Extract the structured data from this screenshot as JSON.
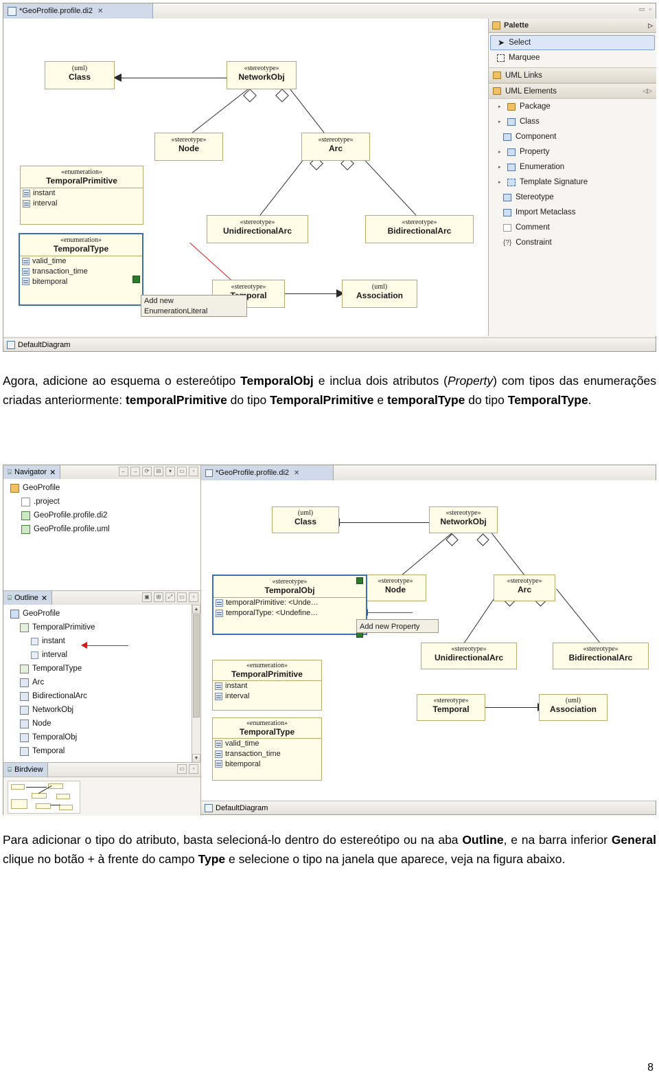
{
  "page": {
    "number": "8"
  },
  "screenshot_top": {
    "editor_tab": {
      "label": "*GeoProfile.profile.di2",
      "close_glyph": "✕",
      "icon": "diagram-icon"
    },
    "window_buttons": {
      "minimize": "▭",
      "maximize": "▫"
    },
    "status_tab": {
      "label": "DefaultDiagram",
      "icon": "diagram-icon"
    },
    "diagram": {
      "classes": [
        {
          "stereotype": "(uml)",
          "name": "Class"
        },
        {
          "stereotype": "«stereotype»",
          "name": "NetworkObj"
        },
        {
          "stereotype": "«stereotype»",
          "name": "Node"
        },
        {
          "stereotype": "«stereotype»",
          "name": "Arc"
        },
        {
          "stereotype": "«stereotype»",
          "name": "UnidirectionalArc"
        },
        {
          "stereotype": "«stereotype»",
          "name": "BidirectionalArc"
        },
        {
          "stereotype": "«stereotype»",
          "name": "Temporal"
        },
        {
          "stereotype": "(uml)",
          "name": "Association"
        }
      ],
      "enumerations": [
        {
          "stereotype": "«enumeration»",
          "name": "TemporalPrimitive",
          "literals": [
            "instant",
            "interval"
          ]
        },
        {
          "stereotype": "«enumeration»",
          "name": "TemporalType",
          "literals": [
            "valid_time",
            "transaction_time",
            "bitemporal"
          ]
        }
      ],
      "hint": "Add new\nEnumerationLiteral",
      "hint_line1": "Add new",
      "hint_line2": "EnumerationLiteral"
    },
    "palette": {
      "title": "Palette",
      "collapse_glyph": "▷",
      "items": [
        {
          "label": "Select",
          "icon": "arrow-cursor-icon",
          "selected": true,
          "type": "tool"
        },
        {
          "label": "Marquee",
          "icon": "marquee-icon",
          "selected": false,
          "type": "tool"
        },
        {
          "label": "UML Links",
          "icon": "folder-icon",
          "type": "group"
        },
        {
          "label": "UML Elements",
          "icon": "folder-icon",
          "type": "group",
          "extra": "◁▷"
        },
        {
          "label": "Package",
          "icon": "package-icon",
          "type": "item",
          "expandable": true
        },
        {
          "label": "Class",
          "icon": "class-icon",
          "type": "item",
          "expandable": true
        },
        {
          "label": "Component",
          "icon": "component-icon",
          "type": "item"
        },
        {
          "label": "Property",
          "icon": "property-icon",
          "type": "item",
          "expandable": true
        },
        {
          "label": "Enumeration",
          "icon": "enumeration-icon",
          "type": "item",
          "expandable": true
        },
        {
          "label": "Template Signature",
          "icon": "template-signature-icon",
          "type": "item",
          "expandable": true
        },
        {
          "label": "Stereotype",
          "icon": "stereotype-icon",
          "type": "item"
        },
        {
          "label": "Import Metaclass",
          "icon": "import-metaclass-icon",
          "type": "item"
        },
        {
          "label": "Comment",
          "icon": "comment-icon",
          "type": "item"
        },
        {
          "label": "Constraint",
          "icon": "constraint-icon",
          "type": "item"
        }
      ]
    }
  },
  "paragraph_1": {
    "segments": [
      {
        "text": "Agora, adicione ao esquema o estereótipo ",
        "style": "normal"
      },
      {
        "text": "TemporalObj",
        "style": "bold"
      },
      {
        "text": " e inclua dois atributos (",
        "style": "normal"
      },
      {
        "text": "Property",
        "style": "italic"
      },
      {
        "text": ") com tipos das enumerações criadas anteriormente: ",
        "style": "normal"
      },
      {
        "text": "temporalPrimitive",
        "style": "bold"
      },
      {
        "text": " do tipo ",
        "style": "normal"
      },
      {
        "text": "TemporalPrimitive",
        "style": "bold"
      },
      {
        "text": " e ",
        "style": "normal"
      },
      {
        "text": "temporalType",
        "style": "bold"
      },
      {
        "text": " do tipo ",
        "style": "normal"
      },
      {
        "text": "TemporalType",
        "style": "bold"
      },
      {
        "text": ".",
        "style": "normal"
      }
    ]
  },
  "screenshot_bottom": {
    "navigator": {
      "tab_label": "Navigator",
      "tab_close": "✕",
      "toolbar_glyphs": [
        "⇦",
        "⇨",
        "⟳",
        "⊟",
        "⇩",
        "▭",
        "▫"
      ],
      "items": [
        {
          "label": "GeoProfile",
          "icon": "project-folder-icon",
          "indent": 0
        },
        {
          "label": ".project",
          "icon": "file-icon",
          "indent": 1
        },
        {
          "label": "GeoProfile.profile.di2",
          "icon": "diagram-file-icon",
          "indent": 1
        },
        {
          "label": "GeoProfile.profile.uml",
          "icon": "uml-file-icon",
          "indent": 1
        }
      ]
    },
    "outline": {
      "tab_label": "Outline",
      "tab_close": "✕",
      "toolbar_glyphs": [
        "▣",
        "⊞",
        "⤢",
        "▭",
        "▫"
      ],
      "items": [
        {
          "label": "GeoProfile",
          "icon": "model-icon",
          "indent": 0
        },
        {
          "label": "TemporalPrimitive",
          "icon": "enumeration-icon",
          "indent": 1
        },
        {
          "label": "instant",
          "icon": "literal-icon",
          "indent": 2
        },
        {
          "label": "interval",
          "icon": "literal-icon",
          "indent": 2
        },
        {
          "label": "TemporalType",
          "icon": "enumeration-icon",
          "indent": 1
        },
        {
          "label": "Arc",
          "icon": "stereotype-icon",
          "indent": 1
        },
        {
          "label": "BidirectionalArc",
          "icon": "stereotype-icon",
          "indent": 1
        },
        {
          "label": "NetworkObj",
          "icon": "stereotype-icon",
          "indent": 1
        },
        {
          "label": "Node",
          "icon": "stereotype-icon",
          "indent": 1
        },
        {
          "label": "TemporalObj",
          "icon": "stereotype-icon",
          "indent": 1
        },
        {
          "label": "Temporal",
          "icon": "stereotype-icon",
          "indent": 1
        }
      ]
    },
    "birdview": {
      "tab_label": "Birdview",
      "minimize": "▭",
      "maximize": "▫"
    },
    "editor_tab": {
      "label": "*GeoProfile.profile.di2",
      "close_glyph": "✕",
      "icon": "diagram-icon"
    },
    "status_tab": {
      "label": "DefaultDiagram",
      "icon": "diagram-icon"
    },
    "diagram": {
      "classes": [
        {
          "stereotype": "(uml)",
          "name": "Class"
        },
        {
          "stereotype": "«stereotype»",
          "name": "NetworkObj"
        },
        {
          "stereotype": "«stereotype»",
          "name": "Node"
        },
        {
          "stereotype": "«stereotype»",
          "name": "Arc"
        },
        {
          "stereotype": "«stereotype»",
          "name": "UnidirectionalArc"
        },
        {
          "stereotype": "«stereotype»",
          "name": "BidirectionalArc"
        },
        {
          "stereotype": "«stereotype»",
          "name": "Temporal"
        },
        {
          "stereotype": "(uml)",
          "name": "Association"
        }
      ],
      "temporal_obj": {
        "stereotype": "«stereotype»",
        "name": "TemporalObj",
        "attributes": [
          "temporalPrimitive: <Unde…",
          "temporalType: <Undefine…"
        ]
      },
      "enumerations": [
        {
          "stereotype": "«enumeration»",
          "name": "TemporalPrimitive",
          "literals": [
            "instant",
            "interval"
          ]
        },
        {
          "stereotype": "«enumeration»",
          "name": "TemporalType",
          "literals": [
            "valid_time",
            "transaction_time",
            "bitemporal"
          ]
        }
      ],
      "hint": "Add new Property"
    }
  },
  "paragraph_2": {
    "segments": [
      {
        "text": "Para adicionar o tipo do atributo, basta selecioná-lo dentro do estereótipo ou na aba ",
        "style": "normal"
      },
      {
        "text": "Outline",
        "style": "bold"
      },
      {
        "text": ", e na barra inferior ",
        "style": "normal"
      },
      {
        "text": "General",
        "style": "bold"
      },
      {
        "text": " clique no botão + à frente do campo ",
        "style": "normal"
      },
      {
        "text": "Type",
        "style": "bold"
      },
      {
        "text": " e selecione o tipo na janela que aparece, veja na figura abaixo.",
        "style": "normal"
      }
    ]
  }
}
